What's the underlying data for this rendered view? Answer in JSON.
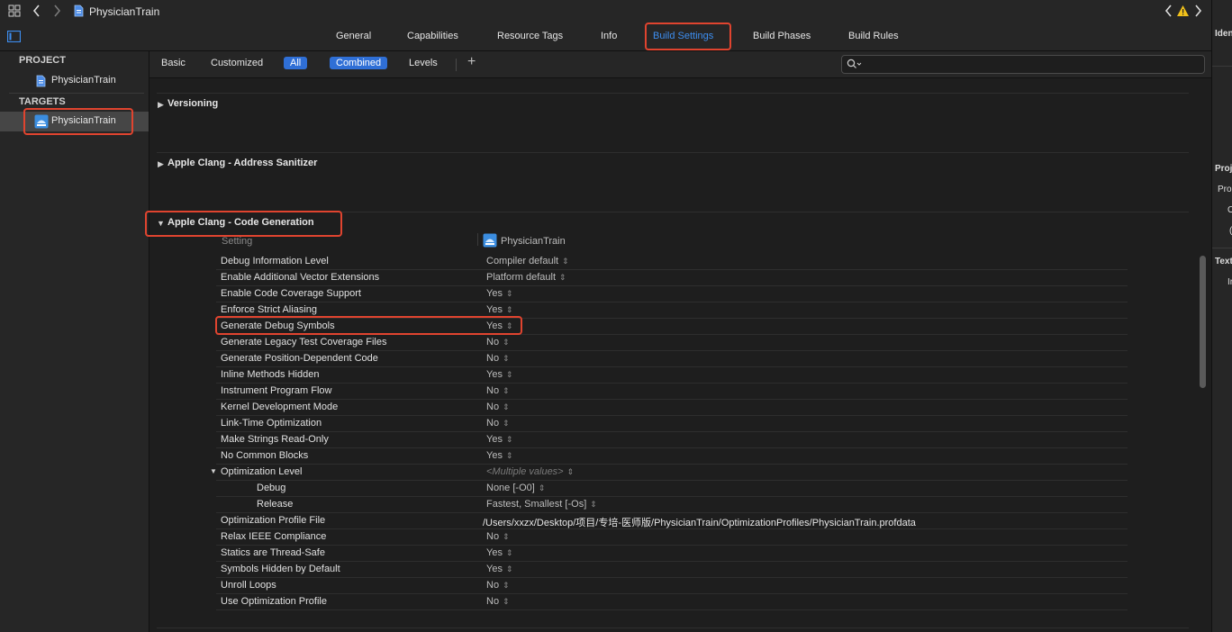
{
  "window": {
    "title": "PhysicianTrain",
    "warning_icon": "warning-icon"
  },
  "tabs": [
    {
      "label": "General"
    },
    {
      "label": "Capabilities"
    },
    {
      "label": "Resource Tags"
    },
    {
      "label": "Info"
    },
    {
      "label": "Build Settings",
      "selected": true
    },
    {
      "label": "Build Phases"
    },
    {
      "label": "Build Rules"
    }
  ],
  "sidebar": {
    "project_header": "PROJECT",
    "project_item": "PhysicianTrain",
    "targets_header": "TARGETS",
    "target_item": "PhysicianTrain"
  },
  "filter": {
    "basic": "Basic",
    "customized": "Customized",
    "all": "All",
    "combined": "Combined",
    "levels": "Levels",
    "add": "+",
    "search_placeholder": ""
  },
  "groups": {
    "versioning": "Versioning",
    "address_sanitizer": "Apple Clang - Address Sanitizer",
    "code_generation": "Apple Clang - Code Generation"
  },
  "table": {
    "setting_header": "Setting",
    "target_header": "PhysicianTrain",
    "rows": [
      {
        "name": "Debug Information Level",
        "value": "Compiler default"
      },
      {
        "name": "Enable Additional Vector Extensions",
        "value": "Platform default"
      },
      {
        "name": "Enable Code Coverage Support",
        "value": "Yes"
      },
      {
        "name": "Enforce Strict Aliasing",
        "value": "Yes"
      },
      {
        "name": "Generate Debug Symbols",
        "value": "Yes"
      },
      {
        "name": "Generate Legacy Test Coverage Files",
        "value": "No"
      },
      {
        "name": "Generate Position-Dependent Code",
        "value": "No"
      },
      {
        "name": "Inline Methods Hidden",
        "value": "Yes"
      },
      {
        "name": "Instrument Program Flow",
        "value": "No"
      },
      {
        "name": "Kernel Development Mode",
        "value": "No"
      },
      {
        "name": "Link-Time Optimization",
        "value": "No"
      },
      {
        "name": "Make Strings Read-Only",
        "value": "Yes"
      },
      {
        "name": "No Common Blocks",
        "value": "Yes"
      },
      {
        "name": "Optimization Level",
        "value": "<Multiple values>"
      },
      {
        "name": "Debug",
        "value": "None [-O0]"
      },
      {
        "name": "Release",
        "value": "Fastest, Smallest [-Os]"
      },
      {
        "name": "Optimization Profile File",
        "value": "/Users/xxzx/Desktop/项目/专培-医师版/PhysicianTrain/OptimizationProfiles/PhysicianTrain.profdata"
      },
      {
        "name": "Relax IEEE Compliance",
        "value": "No"
      },
      {
        "name": "Statics are Thread-Safe",
        "value": "Yes"
      },
      {
        "name": "Symbols Hidden by Default",
        "value": "Yes"
      },
      {
        "name": "Unroll Loops",
        "value": "No"
      },
      {
        "name": "Use Optimization Profile",
        "value": "No"
      }
    ]
  },
  "inspector": {
    "labels": [
      "Iden",
      "Proj",
      "Pro",
      "O",
      "(",
      "Text",
      "Ir"
    ]
  },
  "colors": {
    "accent": "#2f6fd6",
    "highlight": "#e0442f",
    "background": "#1e1e1e",
    "panel": "#262626"
  }
}
